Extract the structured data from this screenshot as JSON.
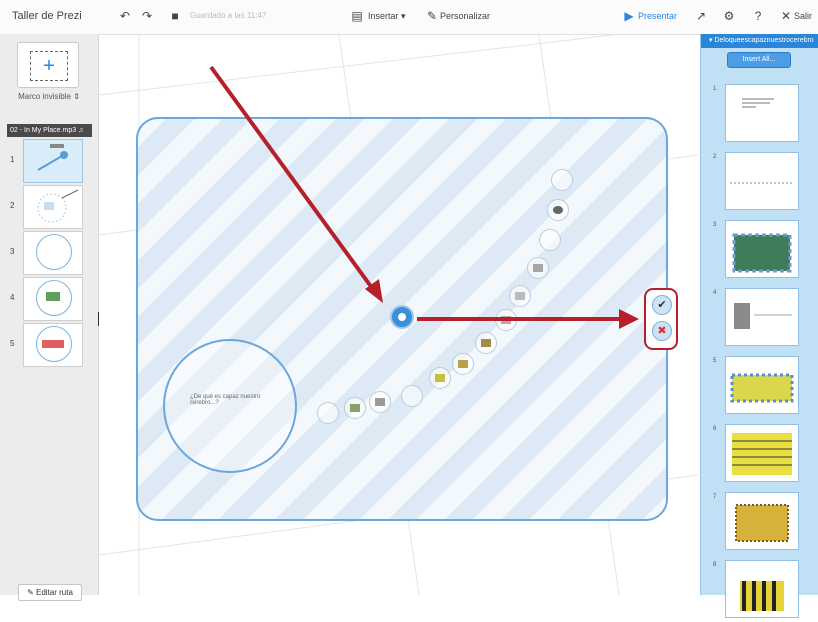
{
  "toolbar": {
    "title": "Taller de Prezi",
    "saved_status": "Guardado a las 11:47",
    "insert_label": "Insertar",
    "customize_label": "Personalizar",
    "present_label": "Presentar",
    "exit_label": "Salir"
  },
  "left_panel": {
    "frame_type": "Marco invisible",
    "audio_track": "02 - In My Place.mp3",
    "slides": [
      {
        "number": "1",
        "active": true
      },
      {
        "number": "2",
        "active": false
      },
      {
        "number": "3",
        "active": false
      },
      {
        "number": "4",
        "active": false
      },
      {
        "number": "5",
        "active": false
      }
    ],
    "edit_path_label": "Editar ruta"
  },
  "canvas": {
    "circle_text": "¿De qué es capaz nuestro cerebro...?"
  },
  "right_panel": {
    "header": "Deloqueescapaznuestrocerebro",
    "insert_all_label": "Insert All...",
    "slide_numbers": [
      "1",
      "2",
      "3",
      "4",
      "5",
      "6",
      "7",
      "8"
    ]
  },
  "colors": {
    "accent": "#2a86d9",
    "frame_border": "#6aa7dc",
    "arrow": "#b5202b",
    "right_panel_bg": "#bfe0f5"
  },
  "icons": [
    "undo-icon",
    "redo-icon",
    "save-icon",
    "insert-icon",
    "pencil-icon",
    "play-icon",
    "share-icon",
    "gear-icon",
    "help-icon",
    "close-icon",
    "music-icon",
    "check-icon",
    "cross-icon"
  ]
}
